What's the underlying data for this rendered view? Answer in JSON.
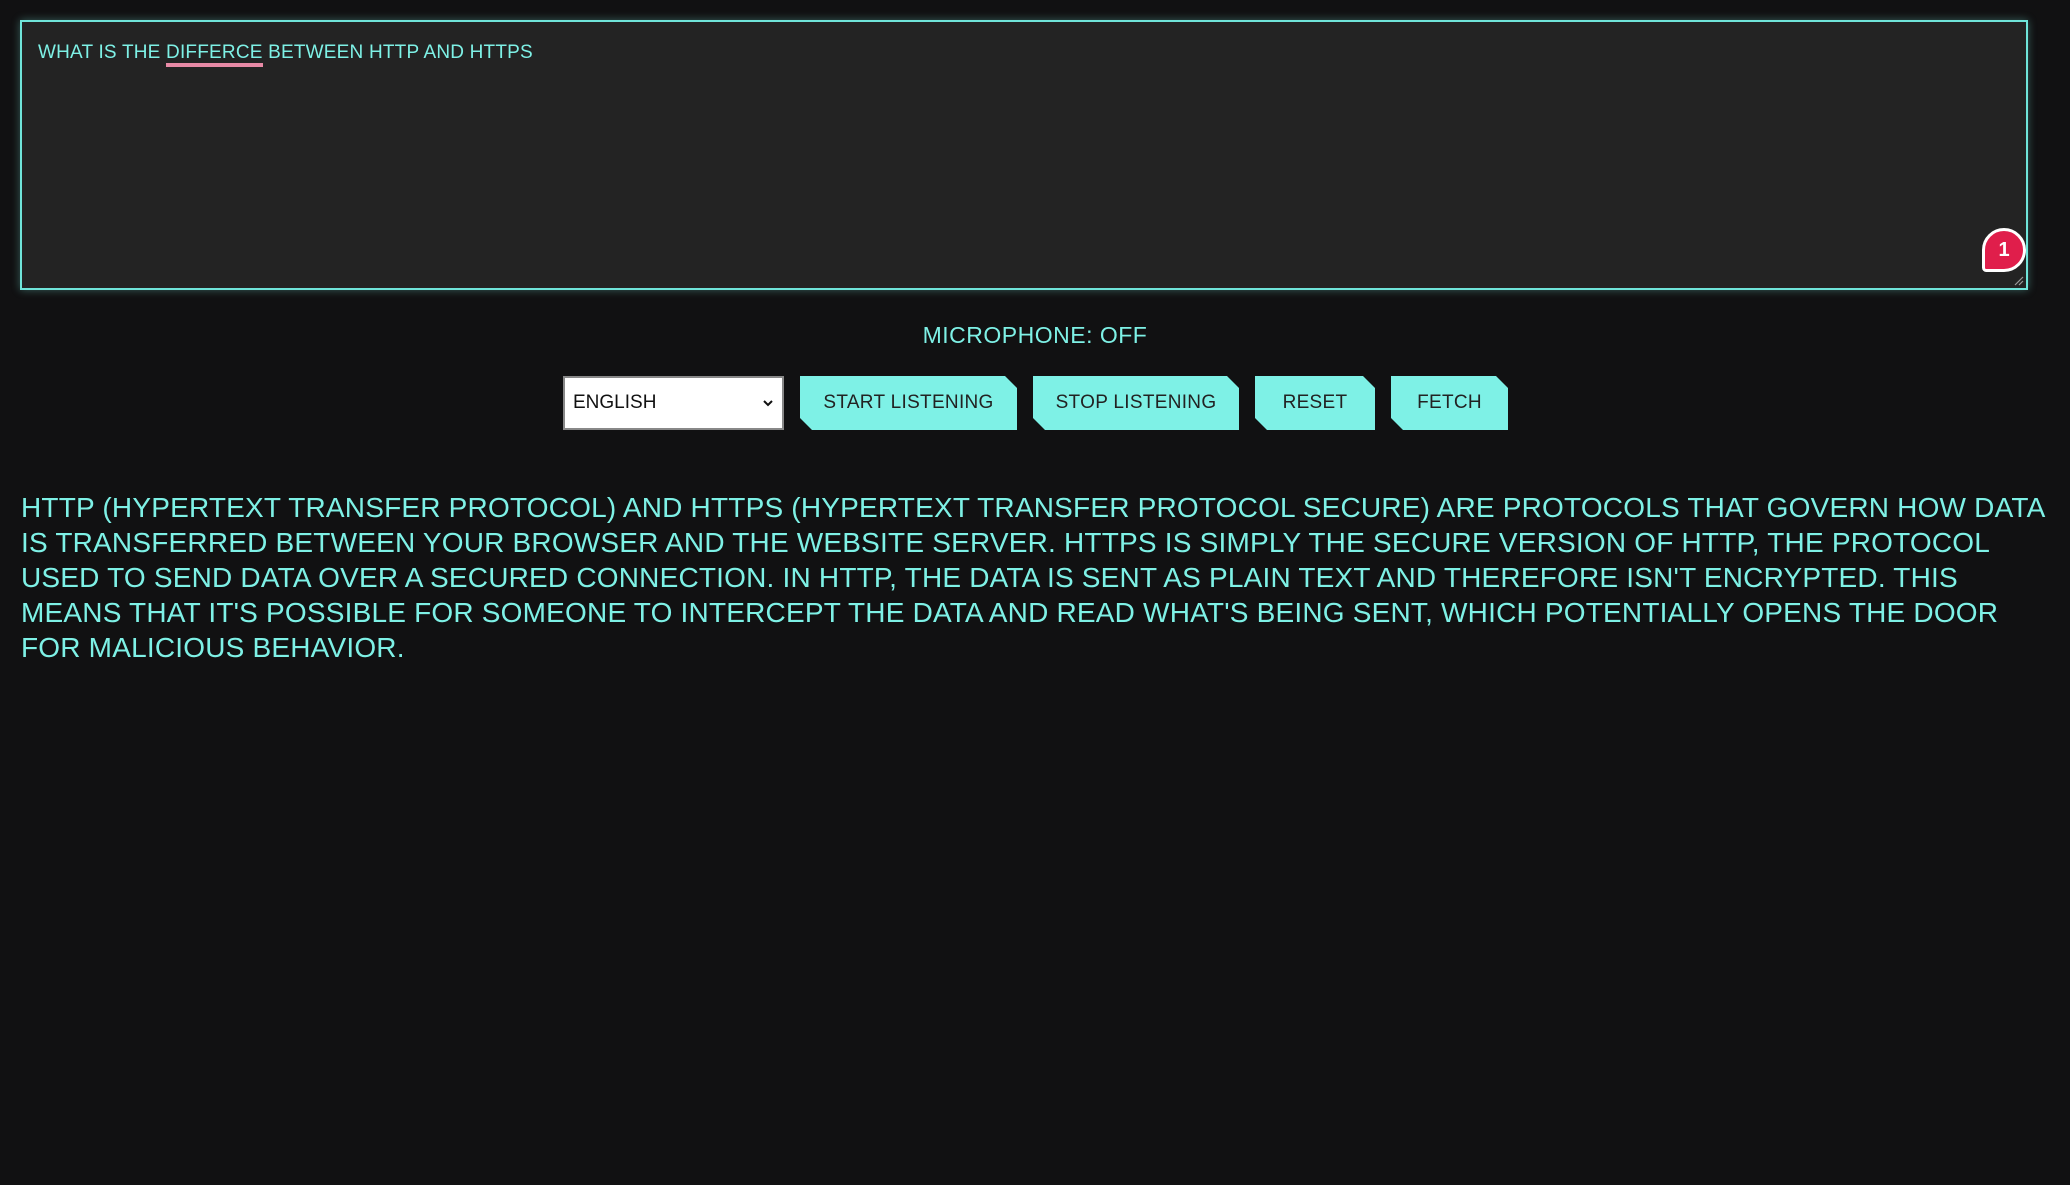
{
  "query": {
    "before": "WHAT IS THE ",
    "misspelled_word": "DIFFERCE",
    "after": " BETWEEN HTTP AND HTTPS"
  },
  "badge": {
    "count": "1"
  },
  "microphone": {
    "status": "MICROPHONE: OFF"
  },
  "controls": {
    "language_selected": "ENGLISH",
    "start_label": "START LISTENING",
    "stop_label": "STOP LISTENING",
    "reset_label": "RESET",
    "fetch_label": "FETCH"
  },
  "answer": {
    "text": "HTTP (HYPERTEXT TRANSFER PROTOCOL) AND HTTPS (HYPERTEXT TRANSFER PROTOCOL SECURE) ARE PROTOCOLS THAT GOVERN HOW DATA IS TRANSFERRED BETWEEN YOUR BROWSER AND THE WEBSITE SERVER. HTTPS IS SIMPLY THE SECURE VERSION OF HTTP, THE PROTOCOL USED TO SEND DATA OVER A SECURED CONNECTION. IN HTTP, THE DATA IS SENT AS PLAIN TEXT AND THEREFORE ISN'T ENCRYPTED. THIS MEANS THAT IT'S POSSIBLE FOR SOMEONE TO INTERCEPT THE DATA AND READ WHAT'S BEING SENT, WHICH POTENTIALLY OPENS THE DOOR FOR MALICIOUS BEHAVIOR."
  },
  "colors": {
    "accent": "#7ef1e6",
    "background": "#111112",
    "textarea_bg": "#232323",
    "badge": "#e01e4b",
    "spellcheck_underline": "#e88aa6"
  },
  "icons": {
    "badge": "notification-badge-icon",
    "select_arrow": "chevron-down-icon",
    "resize": "resize-handle-icon"
  }
}
